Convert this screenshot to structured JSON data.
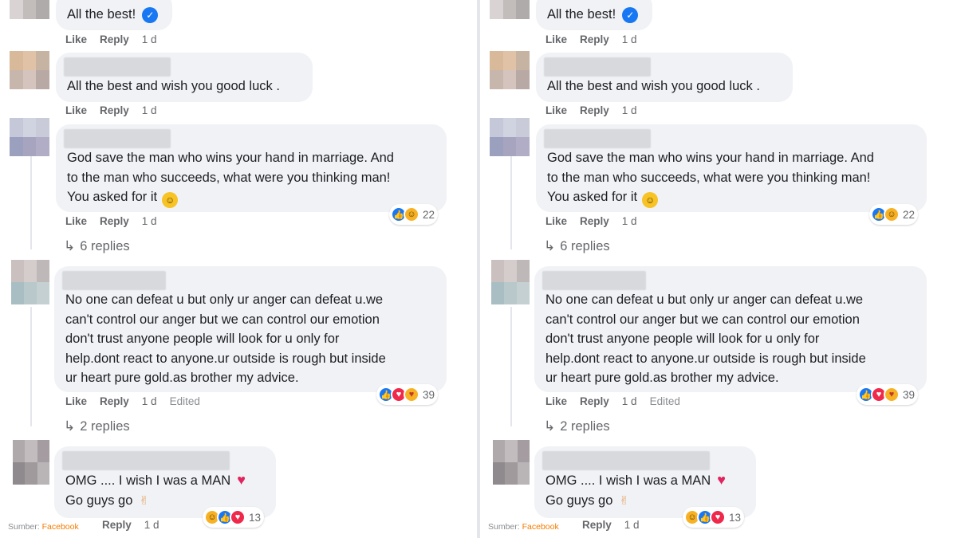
{
  "actions": {
    "like": "Like",
    "reply": "Reply",
    "time": "1 d",
    "edited": "Edited"
  },
  "comments": [
    {
      "text": [
        "All the best!"
      ]
    },
    {
      "text": [
        "All the best and wish you good luck ."
      ]
    },
    {
      "text": [
        "God save the man who wins your hand in marriage. And",
        "to the man who succeeds, what were you thinking man!",
        "You asked for it"
      ],
      "reaction_count": "22",
      "replies": "6 replies"
    },
    {
      "text": [
        "No one can defeat u but only ur anger can defeat u.we",
        "can't control our anger but we can control our emotion",
        "don't trust anyone people will look for u only for",
        "help.dont react to anyone.ur outside is rough but inside",
        "ur heart pure gold.as brother my advice."
      ],
      "reaction_count": "39",
      "replies": "2 replies"
    },
    {
      "text": [
        "OMG .... I wish I was a MAN",
        "Go guys go"
      ],
      "reaction_count": "13"
    }
  ],
  "source": {
    "label": "Sumber: ",
    "site": "Facebook"
  },
  "icons": {
    "verified": "check-badge-icon",
    "smile": "grinning-emoji-icon",
    "heart": "red-heart-icon",
    "hand": "crossed-fingers-icon",
    "reply_arrow": "reply-arrow-icon"
  },
  "colors": {
    "like_blue": "#1877f2",
    "love_red": "#f02849",
    "haha_yellow": "#f7b125",
    "bubble_bg": "#f0f2f5",
    "muted_text": "#65676b"
  }
}
